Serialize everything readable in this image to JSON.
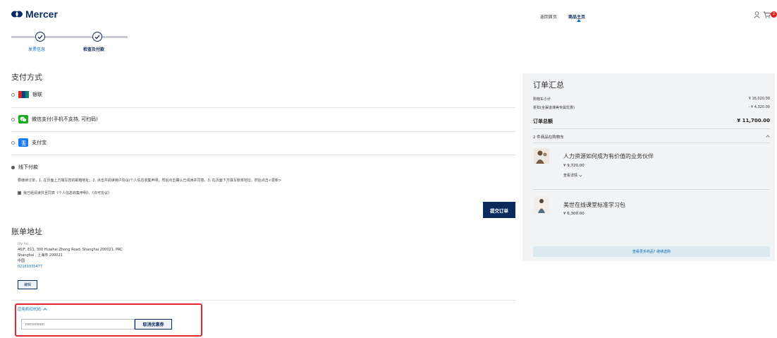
{
  "header": {
    "brand": "Mercer",
    "nav": {
      "home": "返回首页",
      "shop": "商品主页"
    },
    "cart_count": "2"
  },
  "steps": [
    {
      "label": "发票信息"
    },
    {
      "label": "检查及付款"
    }
  ],
  "payment": {
    "title": "支付方式",
    "methods": [
      {
        "label": "银联",
        "icon": "unionpay-icon",
        "color": "#d7281f"
      },
      {
        "label": "微信支付(手机不支持, 可扫码)",
        "icon": "wechat-icon",
        "color": "#1aad19"
      },
      {
        "label": "支付宝",
        "icon": "alipay-icon",
        "color": "#1677ff"
      },
      {
        "label": "线下付款",
        "selected": true
      }
    ],
    "offline_instructions": "要继续订单，1. 在页面上方填写您的邮箱地址；2. 点击并阅读用户协议/个人信息收集声明，然后点击确认已阅读并同意。3. 在页面下方填写账单地址，然后点击<更新>",
    "agree_text": "我已经阅读并且同意《个人信息收集申明》、《许可协议》",
    "submit_label": "提交订单"
  },
  "billing": {
    "title": "账单地址",
    "lines": [
      "lily hu",
      "46/F, E11, 300 Huaihai Zhong Road, Shanghai 200021, PRC",
      "Shanghai , 上海市 200021",
      "中国",
      "02161035477"
    ],
    "edit_label": "编辑"
  },
  "promo": {
    "toggle_label": "应用折扣代码",
    "placeholder": "mercerteam",
    "cancel_label": "取消优惠券"
  },
  "summary": {
    "title": "订单汇总",
    "subtotal_label": "购物车小计",
    "subtotal_value": "¥ 16,020.00",
    "discount_label": "折扣(全渠道课美专属优惠)",
    "discount_value": "- ¥ 4,320.00",
    "total_label": "订单总额",
    "total_value": "¥ 11,700.00",
    "items_heading": "2 件商品在购物车",
    "items": [
      {
        "name": "人力资源如何成为有价值的业务伙伴",
        "price": "¥ 9,720.00",
        "details": "查看详情"
      },
      {
        "name": "美世在线课堂标准学习包",
        "price": "¥ 6,300.00"
      }
    ],
    "more_label": "查看更多商品? 继续选购"
  },
  "colors": {
    "brand": "#0a2a5e",
    "link": "#0a6ebd",
    "alert": "#e5262f"
  }
}
